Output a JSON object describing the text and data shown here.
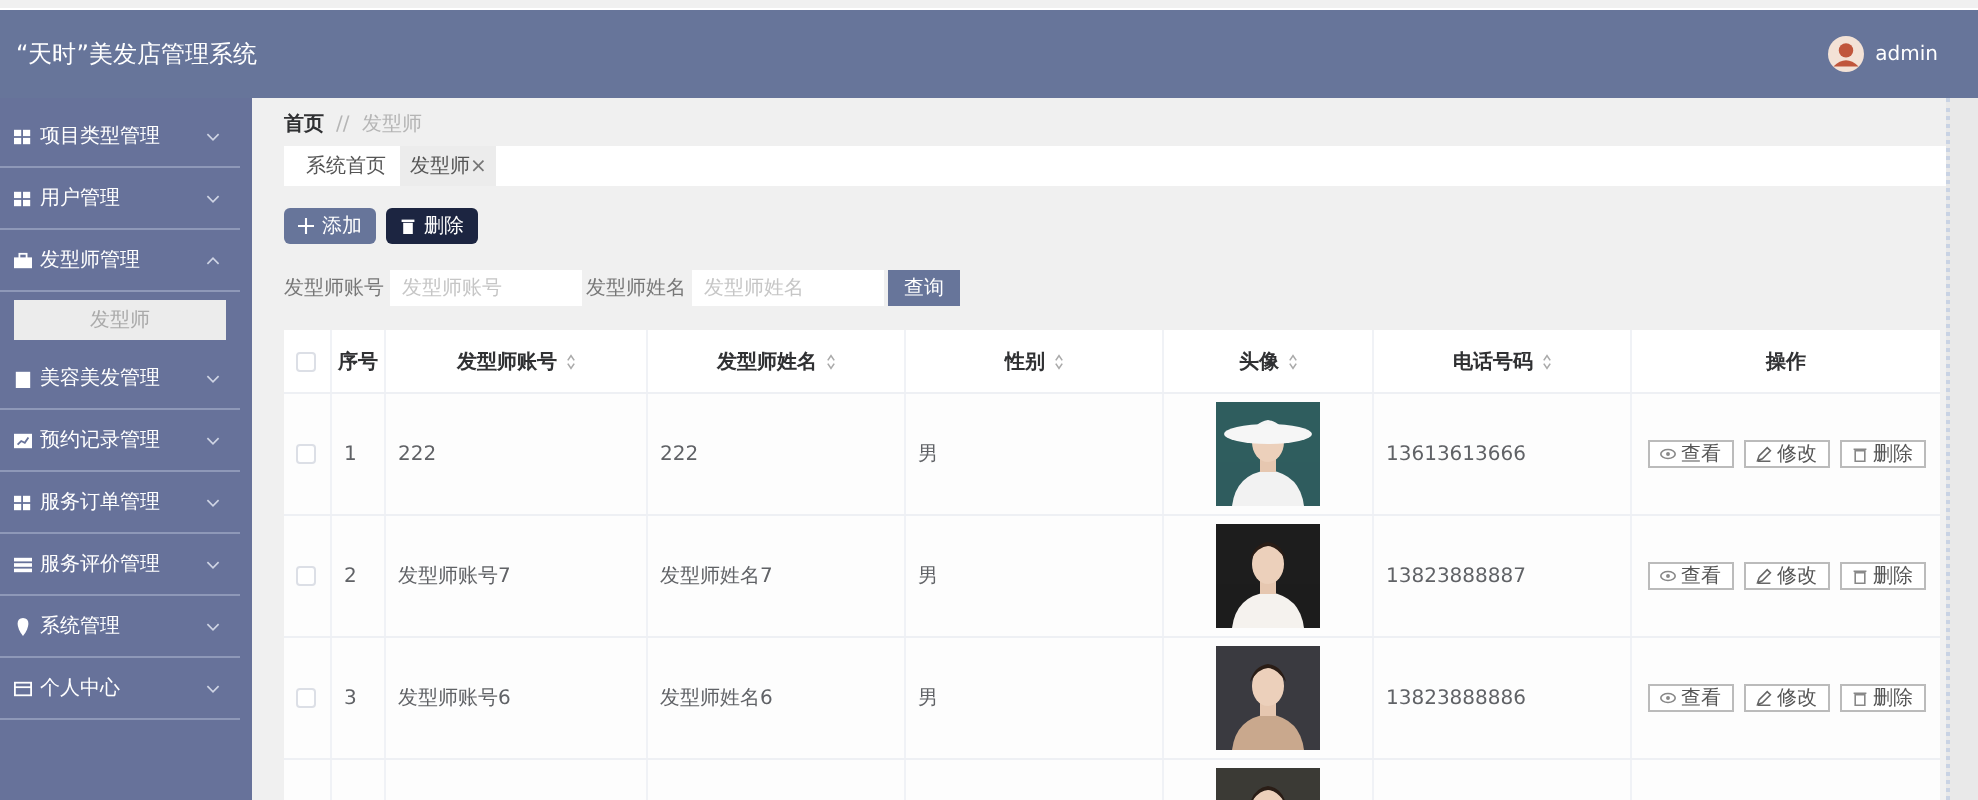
{
  "header": {
    "title": "“天时”美发店管理系统",
    "user": "admin"
  },
  "sidebar": {
    "items": [
      {
        "label": "项目类型管理",
        "expanded": false
      },
      {
        "label": "用户管理",
        "expanded": false
      },
      {
        "label": "发型师管理",
        "expanded": true,
        "children": [
          {
            "label": "发型师",
            "selected": true
          }
        ]
      },
      {
        "label": "美容美发管理",
        "expanded": false
      },
      {
        "label": "预约记录管理",
        "expanded": false
      },
      {
        "label": "服务订单管理",
        "expanded": false
      },
      {
        "label": "服务评价管理",
        "expanded": false
      },
      {
        "label": "系统管理",
        "expanded": false
      },
      {
        "label": "个人中心",
        "expanded": false
      }
    ]
  },
  "breadcrumb": [
    "首页",
    "//",
    "发型师"
  ],
  "tabs": [
    {
      "label": "系统首页",
      "selected": false
    },
    {
      "label": "发型师",
      "selected": true,
      "close": "×"
    }
  ],
  "actions": [
    {
      "label": "添加",
      "kind": "add"
    },
    {
      "label": "删除",
      "kind": "delete"
    }
  ],
  "search": {
    "fields": [
      {
        "label": "发型师账号",
        "placeholder": "发型师账号"
      },
      {
        "label": "发型师姓名",
        "placeholder": "发型师姓名"
      }
    ],
    "button": "查询"
  },
  "table": {
    "select_all": {
      "checked": false
    },
    "columns": [
      {
        "label": "序号",
        "sortable": false
      },
      {
        "label": "发型师账号",
        "sortable": true
      },
      {
        "label": "发型师姓名",
        "sortable": true
      },
      {
        "label": "性别",
        "sortable": true
      },
      {
        "label": "头像",
        "sortable": true
      },
      {
        "label": "电话号码",
        "sortable": true
      },
      {
        "label": "操作",
        "sortable": false
      }
    ],
    "rows": [
      {
        "checked": false,
        "index": "1",
        "account": "222",
        "name": "222",
        "gender": "男",
        "avatar": {
          "kind": "picture"
        },
        "phone": "13613613666",
        "buttons": [
          {
            "label": "查看",
            "kind": "view"
          },
          {
            "label": "修改",
            "kind": "edit"
          },
          {
            "label": "删除",
            "kind": "delete"
          }
        ]
      },
      {
        "checked": false,
        "index": "2",
        "account": "发型师账号7",
        "name": "发型师姓名7",
        "gender": "男",
        "avatar": {
          "kind": "picture"
        },
        "phone": "13823888887",
        "buttons": [
          {
            "label": "查看",
            "kind": "view"
          },
          {
            "label": "修改",
            "kind": "edit"
          },
          {
            "label": "删除",
            "kind": "delete"
          }
        ]
      },
      {
        "checked": false,
        "index": "3",
        "account": "发型师账号6",
        "name": "发型师姓名6",
        "gender": "男",
        "avatar": {
          "kind": "picture"
        },
        "phone": "13823888886",
        "buttons": [
          {
            "label": "查看",
            "kind": "view"
          },
          {
            "label": "修改",
            "kind": "edit"
          },
          {
            "label": "删除",
            "kind": "delete"
          }
        ]
      },
      {
        "avatar": {
          "kind": "picture"
        }
      }
    ]
  }
}
